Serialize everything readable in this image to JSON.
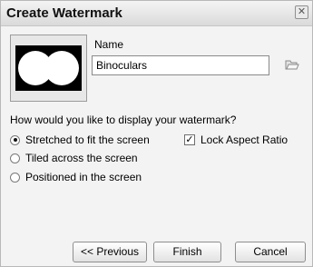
{
  "dialog": {
    "title": "Create Watermark",
    "close_glyph": "✕"
  },
  "preview": {
    "icon": "binoculars-icon"
  },
  "name": {
    "label": "Name",
    "value": "Binoculars",
    "browse_icon": "folder-icon"
  },
  "display": {
    "question": "How would you like to display your watermark?",
    "options": [
      {
        "label": "Stretched to fit the screen",
        "checked": true
      },
      {
        "label": "Tiled across the screen",
        "checked": false
      },
      {
        "label": "Positioned in the screen",
        "checked": false
      }
    ],
    "lock_aspect": {
      "label": "Lock Aspect Ratio",
      "checked": true,
      "glyph": "✓"
    }
  },
  "buttons": {
    "previous": "<< Previous",
    "finish": "Finish",
    "cancel": "Cancel"
  }
}
